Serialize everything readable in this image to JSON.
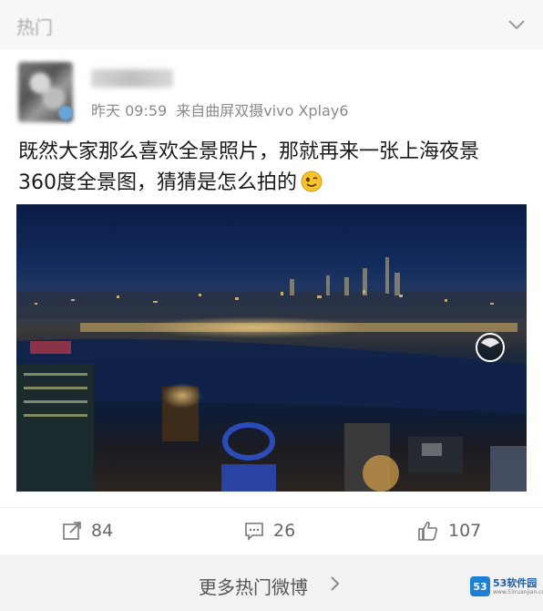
{
  "header": {
    "title": "热门",
    "chevron_icon": "chevron-down-icon"
  },
  "post": {
    "username_blurred": true,
    "time": "昨天 09:59",
    "source": "来自曲屏双摄vivo Xplay6",
    "text_line1": "既然大家那么喜欢全景照片，那就再来一张上海夜景",
    "text_line2": "360度全景图，猜猜是怎么拍的",
    "emoji": "smile-emoji-icon",
    "image": {
      "pano_icon": "panorama-360-icon"
    }
  },
  "actions": {
    "repost_count": "84",
    "comment_count": "26",
    "like_count": "107"
  },
  "footer": {
    "more_label": "更多热门微博"
  },
  "watermark": {
    "title": "53软件园",
    "url": "www.53ruanjian.com"
  },
  "colors": {
    "accent": "#1e7fd6",
    "meta_text": "#8a8a8a"
  }
}
